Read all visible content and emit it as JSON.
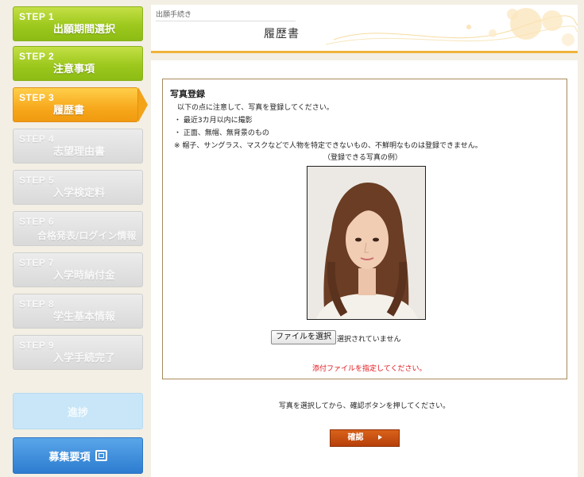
{
  "sidebar": {
    "steps": [
      {
        "num": "STEP 1",
        "title": "出願期間選択",
        "state": "done"
      },
      {
        "num": "STEP 2",
        "title": "注意事項",
        "state": "done"
      },
      {
        "num": "STEP 3",
        "title": "履歴書",
        "state": "current"
      },
      {
        "num": "STEP 4",
        "title": "志望理由書",
        "state": "todo"
      },
      {
        "num": "STEP 5",
        "title": "入学検定料",
        "state": "todo"
      },
      {
        "num": "STEP 6",
        "title": "合格発表/ログイン情報",
        "state": "todo"
      },
      {
        "num": "STEP 7",
        "title": "入学時納付金",
        "state": "todo"
      },
      {
        "num": "STEP 8",
        "title": "学生基本情報",
        "state": "todo"
      },
      {
        "num": "STEP 9",
        "title": "入学手続完了",
        "state": "todo"
      }
    ],
    "progress_label": "進捗",
    "guide_label": "募集要項"
  },
  "header": {
    "subtitle": "出願手続き",
    "title": "履歴書"
  },
  "photo": {
    "heading": "写真登録",
    "intro": "以下の点に注意して、写真を登録してください。",
    "rule1": "・ 最近3カ月以内に撮影",
    "rule2": "・ 正面、無帽、無背景のもの",
    "note": "※ 帽子、サングラス、マスクなどで人物を特定できないもの、不鮮明なものは登録できません。",
    "example_caption": "（登録できる写真の例）",
    "file_button": "ファイルを選択",
    "no_file": "選択されていません",
    "error": "添付ファイルを指定してください。"
  },
  "footer": {
    "instruction": "写真を選択してから、確認ボタンを押してください。",
    "confirm_label": "確認"
  },
  "colors": {
    "done": "#9dc81d",
    "current": "#f7a81c",
    "todo": "#d9d9d9",
    "accent_border": "#f0b33a",
    "error": "#e0141a",
    "confirm": "#c04a0e"
  }
}
